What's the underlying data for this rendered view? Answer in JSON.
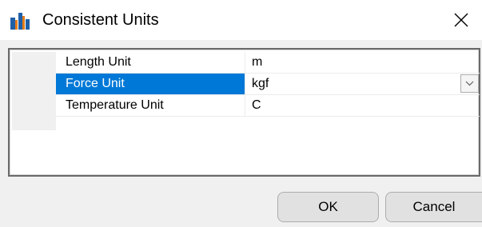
{
  "window": {
    "title": "Consistent Units",
    "close_icon": "close-icon",
    "app_icon": "bar-chart-app-icon"
  },
  "properties": [
    {
      "name": "Length Unit",
      "value": "m",
      "selected": false
    },
    {
      "name": "Force Unit",
      "value": "kgf",
      "selected": true
    },
    {
      "name": "Temperature Unit",
      "value": "C",
      "selected": false
    }
  ],
  "buttons": {
    "ok_label": "OK",
    "cancel_label": "Cancel"
  },
  "colors": {
    "selection": "#0078d7",
    "dialog_bg": "#f0f0f0"
  }
}
